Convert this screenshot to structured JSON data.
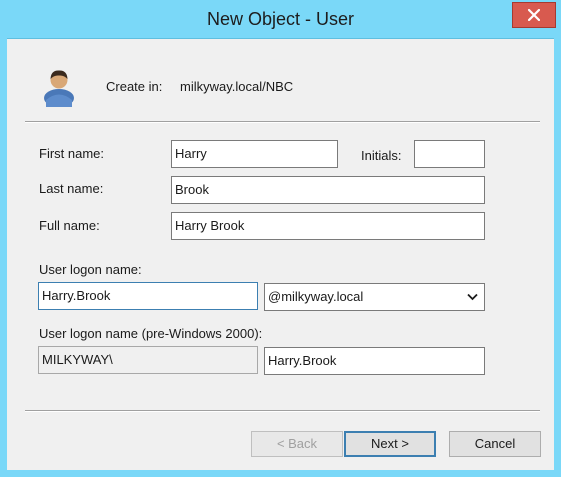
{
  "window": {
    "title": "New Object - User"
  },
  "header": {
    "create_in_label": "Create in:",
    "create_in_value": "milkyway.local/NBC"
  },
  "form": {
    "first_name_label": "First name:",
    "first_name_value": "Harry",
    "initials_label": "Initials:",
    "initials_value": "",
    "last_name_label": "Last name:",
    "last_name_value": "Brook",
    "full_name_label": "Full name:",
    "full_name_value": "Harry Brook",
    "logon_name_label": "User logon name:",
    "logon_name_value": "Harry.Brook",
    "domain_suffix_value": "@milkyway.local",
    "pre2000_label": "User logon name (pre-Windows 2000):",
    "pre2000_domain_value": "MILKYWAY\\",
    "pre2000_name_value": "Harry.Brook"
  },
  "buttons": {
    "back": "< Back",
    "next": "Next >",
    "cancel": "Cancel"
  },
  "icons": {
    "close": "close-icon",
    "user": "user-icon",
    "dropdown": "chevron-down-icon"
  },
  "colors": {
    "titlebar": "#7ad8f8",
    "close": "#d85a4f",
    "focus_border": "#3c7fb1"
  }
}
